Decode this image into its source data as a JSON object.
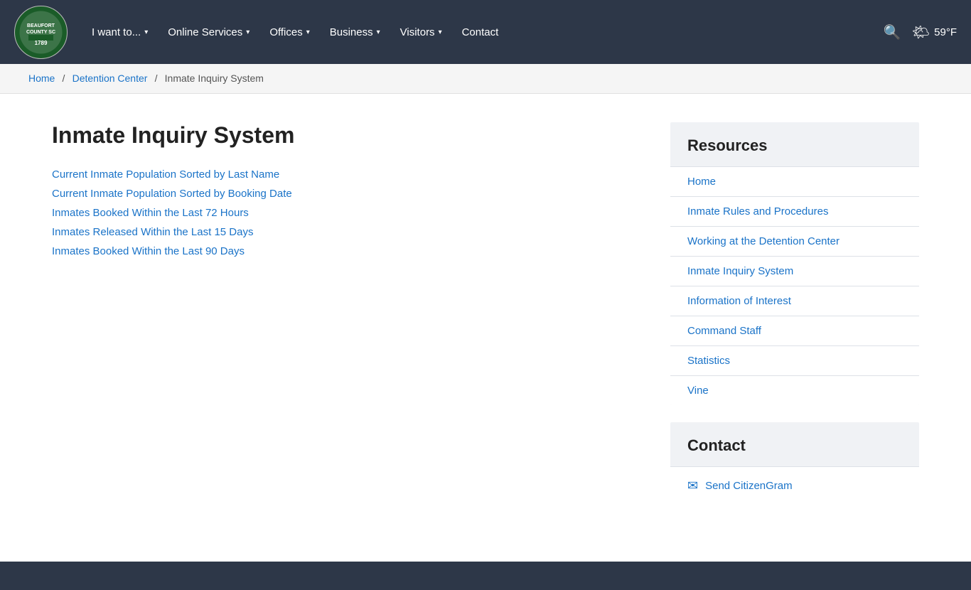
{
  "navbar": {
    "logo_alt": "Beaufort County South Carolina 1789",
    "nav_items": [
      {
        "label": "I want to...",
        "has_dropdown": true
      },
      {
        "label": "Online Services",
        "has_dropdown": true
      },
      {
        "label": "Offices",
        "has_dropdown": true
      },
      {
        "label": "Business",
        "has_dropdown": true
      },
      {
        "label": "Visitors",
        "has_dropdown": true
      },
      {
        "label": "Contact",
        "has_dropdown": false
      }
    ],
    "search_icon": "🔍",
    "weather_icon": "🌤",
    "temperature": "59°F"
  },
  "breadcrumb": {
    "home_label": "Home",
    "detention_label": "Detention Center",
    "current_label": "Inmate Inquiry System"
  },
  "main": {
    "page_title": "Inmate Inquiry System",
    "links": [
      {
        "label": "Current Inmate Population Sorted by Last Name"
      },
      {
        "label": "Current Inmate Population Sorted by Booking Date"
      },
      {
        "label": "Inmates Booked Within the Last 72 Hours"
      },
      {
        "label": "Inmates Released Within the Last 15 Days"
      },
      {
        "label": "Inmates Booked Within the Last 90 Days"
      }
    ]
  },
  "sidebar": {
    "resources_title": "Resources",
    "resource_links": [
      {
        "label": "Home"
      },
      {
        "label": "Inmate Rules and Procedures"
      },
      {
        "label": "Working at the Detention Center"
      },
      {
        "label": "Inmate Inquiry System"
      },
      {
        "label": "Information of Interest"
      },
      {
        "label": "Command Staff"
      },
      {
        "label": "Statistics"
      },
      {
        "label": "Vine"
      }
    ],
    "contact_title": "Contact",
    "contact_link_label": "Send CitizenGram"
  }
}
